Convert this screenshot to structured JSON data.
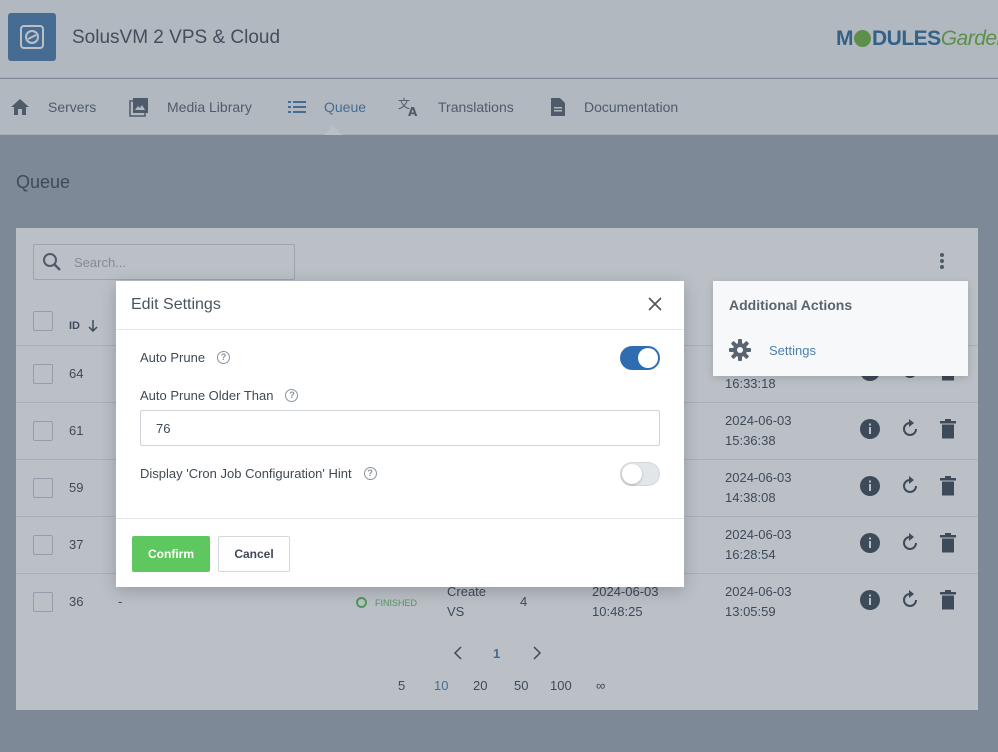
{
  "app": {
    "title": "SolusVM 2 VPS & Cloud",
    "brand_m": "M",
    "brand_dules": "DULES",
    "brand_garden": "Garden"
  },
  "nav": {
    "items": [
      {
        "label": "Servers",
        "icon": "home-icon"
      },
      {
        "label": "Media Library",
        "icon": "image-icon"
      },
      {
        "label": "Queue",
        "icon": "list-icon",
        "active": true
      },
      {
        "label": "Translations",
        "icon": "translate-icon"
      },
      {
        "label": "Documentation",
        "icon": "document-icon"
      }
    ]
  },
  "page": {
    "title": "Queue"
  },
  "table": {
    "search_placeholder": "Search...",
    "id_header": "ID",
    "rows": [
      {
        "id": "64",
        "date2": "16:33:18"
      },
      {
        "id": "61",
        "date2": "2024-06-03",
        "time2": "15:36:38"
      },
      {
        "id": "59",
        "date2": "2024-06-03",
        "time2": "14:38:08"
      },
      {
        "id": "37",
        "date2": "2024-06-03",
        "time2": "16:28:54"
      },
      {
        "id": "36",
        "col2": "-",
        "status": "FINISHED",
        "task1": "Create",
        "task2": "VS",
        "attempts": "4",
        "date1": "2024-06-03",
        "time1": "10:48:25",
        "date2": "2024-06-03",
        "time2": "13:05:59"
      }
    ]
  },
  "pagination": {
    "current": "1",
    "page_sizes": [
      "5",
      "10",
      "20",
      "50",
      "100",
      "∞"
    ],
    "active_size": "10"
  },
  "dropdown": {
    "title": "Additional Actions",
    "settings_label": "Settings"
  },
  "modal": {
    "title": "Edit Settings",
    "auto_prune_label": "Auto Prune",
    "auto_prune_on": true,
    "older_than_label": "Auto Prune Older Than",
    "older_than_value": "76",
    "cron_hint_label": "Display 'Cron Job Configuration' Hint",
    "cron_hint_on": false,
    "confirm_label": "Confirm",
    "cancel_label": "Cancel",
    "help_glyph": "?"
  },
  "colors": {
    "accent": "#2f6db3",
    "confirm": "#5fc75f",
    "status_finished": "#5fbf5f"
  }
}
